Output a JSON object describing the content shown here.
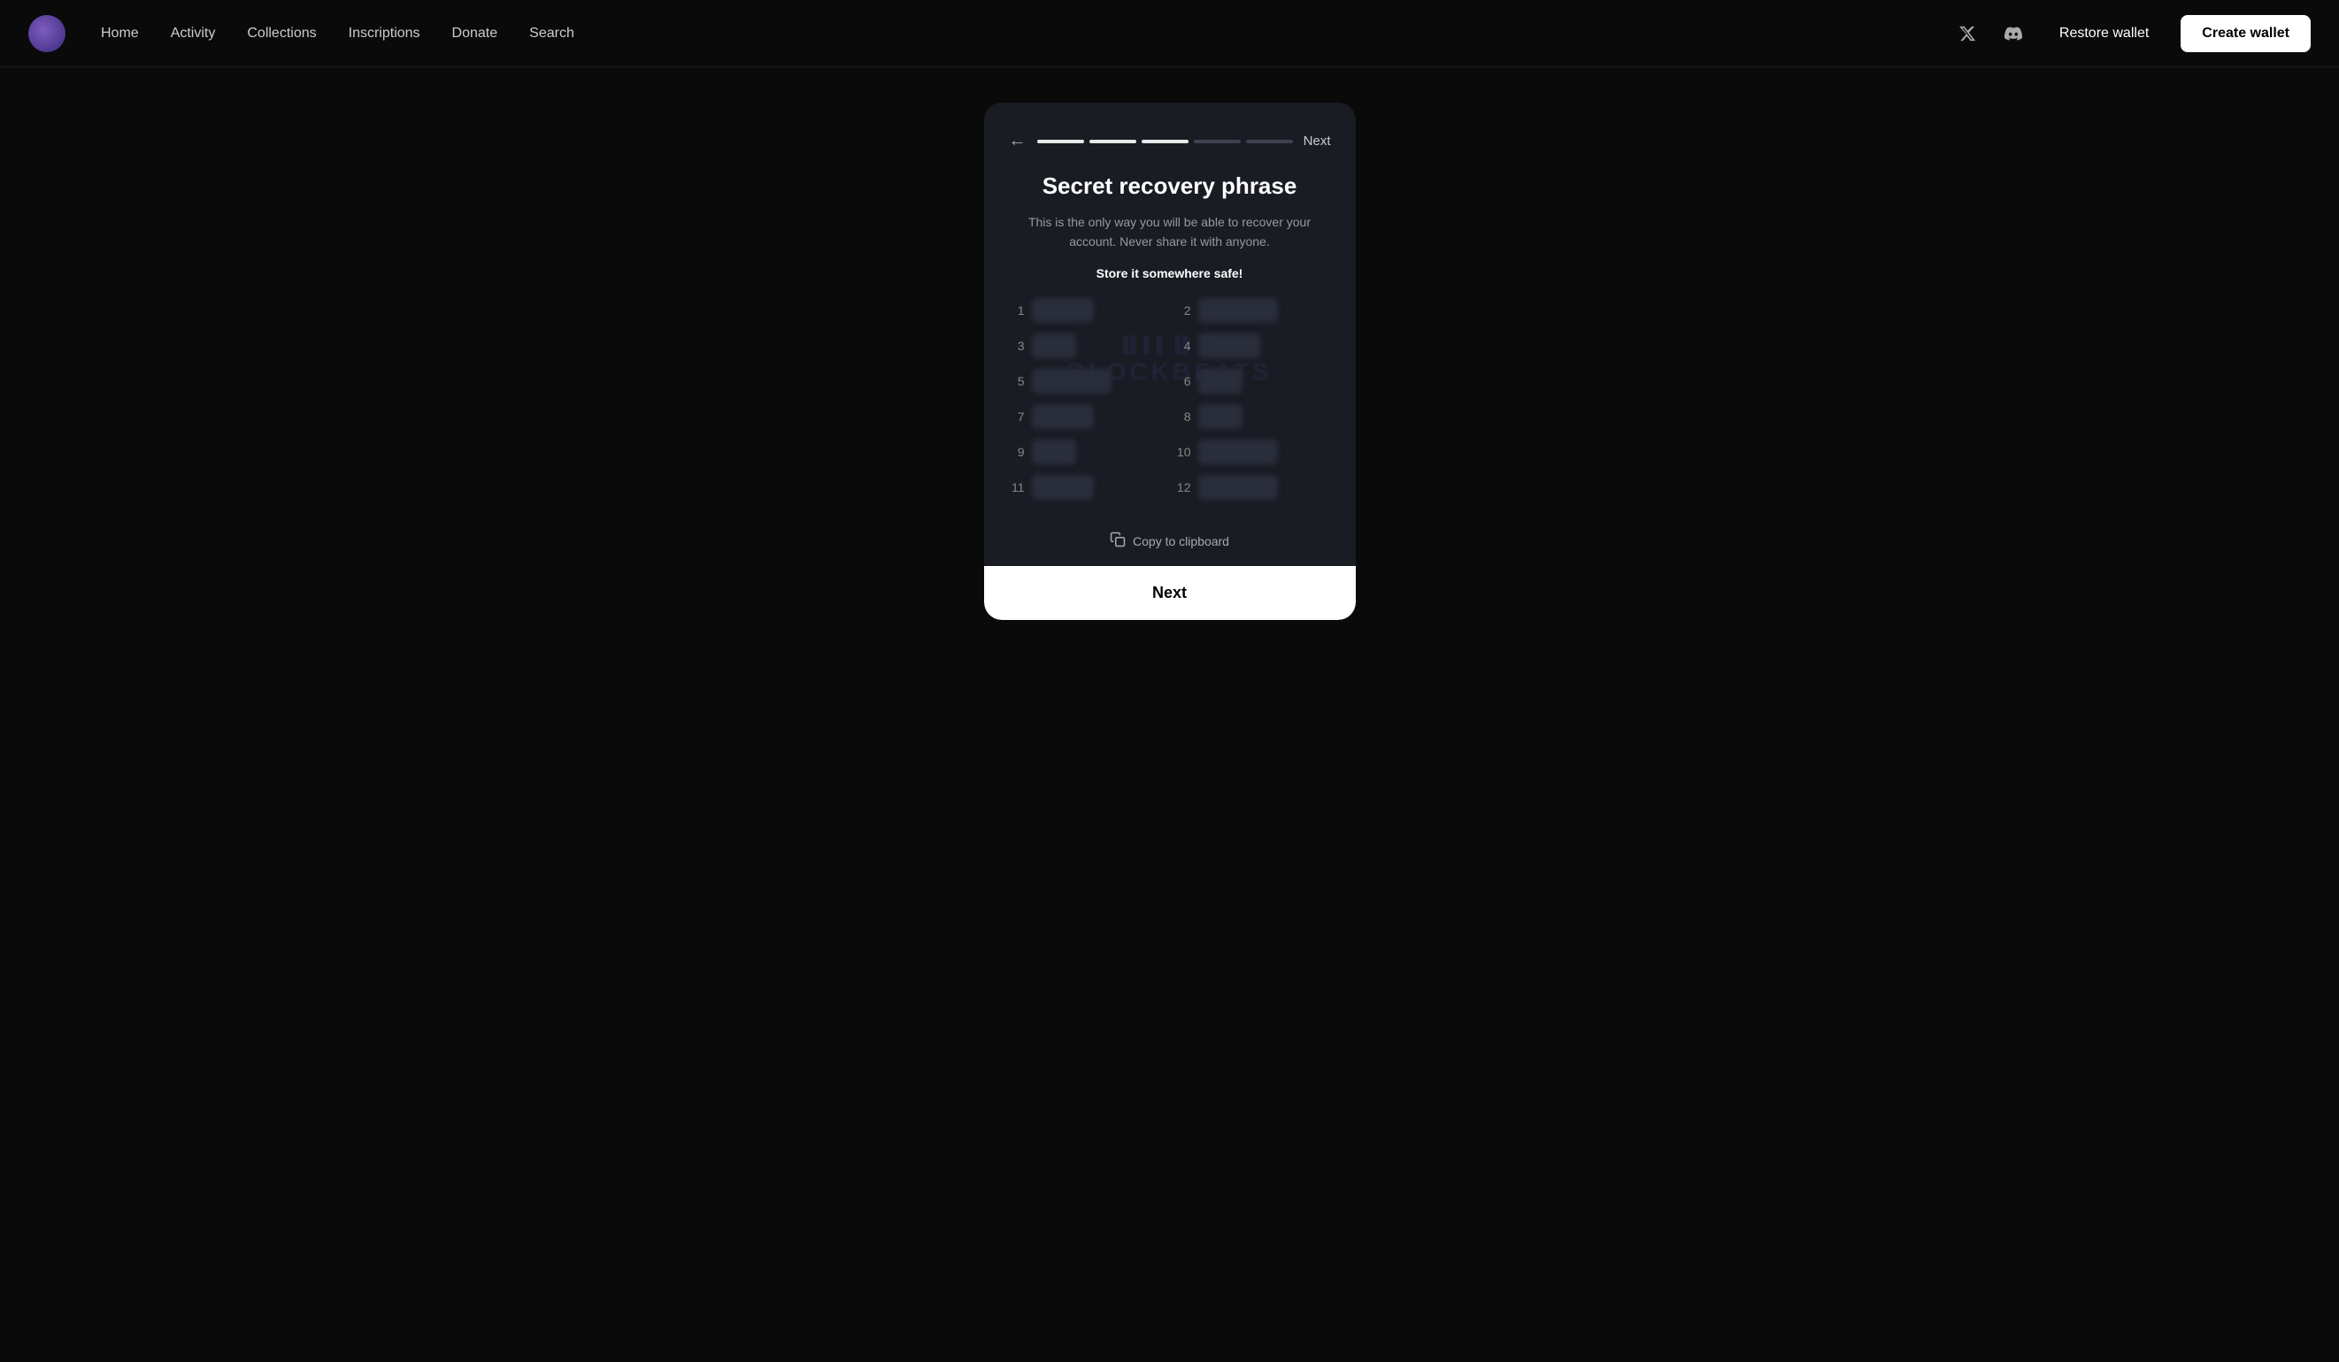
{
  "navbar": {
    "logo_alt": "App logo",
    "links": [
      {
        "label": "Home",
        "id": "home"
      },
      {
        "label": "Activity",
        "id": "activity"
      },
      {
        "label": "Collections",
        "id": "collections"
      },
      {
        "label": "Inscriptions",
        "id": "inscriptions"
      },
      {
        "label": "Donate",
        "id": "donate"
      },
      {
        "label": "Search",
        "id": "search"
      }
    ],
    "restore_label": "Restore wallet",
    "create_label": "Create wallet",
    "twitter_label": "Twitter",
    "discord_label": "Discord"
  },
  "modal": {
    "back_icon": "←",
    "progress_bars": [
      {
        "state": "active"
      },
      {
        "state": "active"
      },
      {
        "state": "active"
      },
      {
        "state": "inactive"
      },
      {
        "state": "inactive"
      }
    ],
    "next_step_label": "Next",
    "title": "Secret recovery phrase",
    "description": "This is the only way you will be able to recover your account. Never share it with anyone.",
    "store_safe_label": "Store it somewhere safe!",
    "watermark_text": "BLOCKBEATS",
    "words": [
      {
        "num": "1",
        "size": "medium"
      },
      {
        "num": "2",
        "size": "long"
      },
      {
        "num": "3",
        "size": "short"
      },
      {
        "num": "4",
        "size": "medium"
      },
      {
        "num": "5",
        "size": "long"
      },
      {
        "num": "6",
        "size": "short"
      },
      {
        "num": "7",
        "size": "medium"
      },
      {
        "num": "8",
        "size": "short"
      },
      {
        "num": "9",
        "size": "short"
      },
      {
        "num": "10",
        "size": "long"
      },
      {
        "num": "11",
        "size": "medium"
      },
      {
        "num": "12",
        "size": "long"
      }
    ],
    "copy_label": "Copy to clipboard",
    "next_btn_label": "Next"
  }
}
